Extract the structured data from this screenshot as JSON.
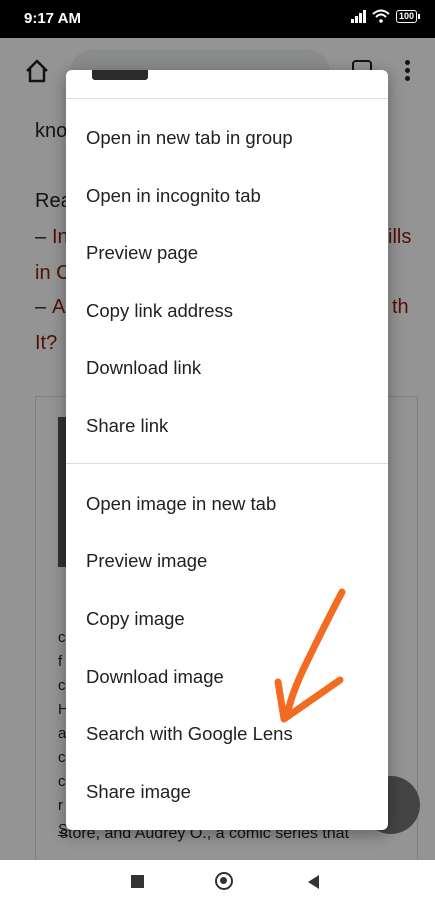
{
  "status_bar": {
    "time": "9:17 AM",
    "battery": "100"
  },
  "page": {
    "line1": "kno",
    "line2": "Rea",
    "line3_prefix": "– ",
    "line3_red": "In",
    "line3_right": "ills",
    "line4": "in C",
    "line5_prefix": "– ",
    "line5_red": "A",
    "line5_right": "th",
    "line6": "It?",
    "card_letters": [
      "c",
      "f",
      "c",
      "H",
      "a",
      "c",
      "c",
      "r",
      "S"
    ],
    "card_line1": "store, and Audrey O., a comic series that"
  },
  "menu": {
    "group1": [
      "Open in new tab in group",
      "Open in incognito tab",
      "Preview page",
      "Copy link address",
      "Download link",
      "Share link"
    ],
    "group2": [
      "Open image in new tab",
      "Preview image",
      "Copy image",
      "Download image",
      "Search with Google Lens",
      "Share image"
    ]
  },
  "colors": {
    "annotation_arrow": "#f26b21",
    "link_red": "#8b1c0f"
  }
}
